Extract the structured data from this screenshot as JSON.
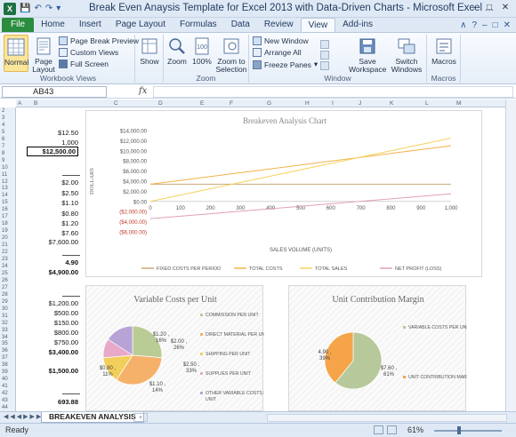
{
  "window": {
    "title": "Break Even Anaysis Template for Excel 2013 with Data-Driven Charts  -  Microsoft Excel ...",
    "file_tab": "File",
    "tabs": [
      "Home",
      "Insert",
      "Page Layout",
      "Formulas",
      "Data",
      "Review",
      "View",
      "Add-ins"
    ],
    "active_tab": "View"
  },
  "ribbon": {
    "workbook_views": {
      "label": "Workbook Views",
      "normal": "Normal",
      "page_layout": "Page Layout",
      "page_break_preview": "Page Break Preview",
      "custom_views": "Custom Views",
      "full_screen": "Full Screen"
    },
    "show": {
      "label": "Show"
    },
    "zoom": {
      "label": "Zoom",
      "zoom": "Zoom",
      "hundred": "100%",
      "zoom_to_selection": "Zoom to Selection"
    },
    "window": {
      "label": "Window",
      "new_window": "New Window",
      "arrange_all": "Arrange All",
      "freeze_panes": "Freeze Panes",
      "save_workspace": "Save Workspace",
      "switch_windows": "Switch Windows"
    },
    "macros": {
      "label": "Macros",
      "macros": "Macros"
    }
  },
  "formula_bar": {
    "name_box": "AB43",
    "fx": "fx",
    "formula": ""
  },
  "columns": [
    "A",
    "B",
    "C",
    "D",
    "E",
    "F",
    "G",
    "H",
    "I",
    "J",
    "K",
    "L",
    "M"
  ],
  "rows": [
    "2",
    "3",
    "4",
    "5",
    "6",
    "7",
    "8",
    "9",
    "10",
    "11",
    "12",
    "13",
    "14",
    "15",
    "16",
    "17",
    "18",
    "19",
    "20",
    "21",
    "22",
    "23",
    "24",
    "25",
    "26",
    "27",
    "28",
    "29",
    "30",
    "31",
    "32",
    "33",
    "34",
    "35",
    "36",
    "37",
    "38",
    "39",
    "40",
    "41",
    "42",
    "43",
    "44"
  ],
  "cells": {
    "v1": "$12.50",
    "v2": "1,000",
    "v3": "$12,500.00",
    "v4": "$2.00",
    "v5": "$2.50",
    "v6": "$1.10",
    "v7": "$0.80",
    "v8": "$1.20",
    "v9": "$7.60",
    "v10": "$7,600.00",
    "v11": "4.90",
    "v12": "$4,900.00",
    "v13": "$1,200.00",
    "v14": "$500.00",
    "v15": "$150.00",
    "v16": "$800.00",
    "v17": "$750.00",
    "v18": "$3,400.00",
    "v19": "$1,500.00",
    "v20": "693.88"
  },
  "sheet_tab": "BREAKEVEN ANALYSIS",
  "status": {
    "ready": "Ready",
    "zoom": "61%"
  },
  "colors": {
    "fixed": "#e8c99a",
    "total_costs": "#f2b24a",
    "total_sales": "#f5d35a",
    "net_profit": "#e9b3c4",
    "variable": "#8cc6ea",
    "contribution": "#f7a24d"
  },
  "chart_data": [
    {
      "type": "line",
      "title": "Breakeven  Analysis  Chart",
      "xlabel": "SALES VOLUME (UNITS)",
      "ylabel": "DOLLARS",
      "x": [
        0,
        100,
        200,
        300,
        400,
        500,
        600,
        700,
        800,
        900,
        1000
      ],
      "x_ticks": [
        "0",
        "100",
        "200",
        "300",
        "400",
        "500",
        "600",
        "700",
        "800",
        "900",
        "1,000"
      ],
      "ylim": [
        -6000,
        14000
      ],
      "y_ticks": [
        "$14,000.00",
        "$12,000.00",
        "$10,000.00",
        "$8,000.00",
        "$6,000.00",
        "$4,000.00",
        "$2,000.00",
        "$0.00",
        "($2,000.00)",
        "($4,000.00)",
        "($6,000.00)"
      ],
      "y_tick_values": [
        14000,
        12000,
        10000,
        8000,
        6000,
        4000,
        2000,
        0,
        -2000,
        -4000,
        -6000
      ],
      "series": [
        {
          "name": "FIXED COSTS PER PERIOD",
          "color": "#c9a878",
          "values": [
            3400,
            3400,
            3400,
            3400,
            3400,
            3400,
            3400,
            3400,
            3400,
            3400,
            3400
          ]
        },
        {
          "name": "TOTAL COSTS",
          "color": "#f2b24a",
          "values": [
            3400,
            4160,
            4920,
            5680,
            6440,
            7200,
            7960,
            8720,
            9480,
            10240,
            11000
          ]
        },
        {
          "name": "TOTAL SALES",
          "color": "#f5d35a",
          "values": [
            0,
            1250,
            2500,
            3750,
            5000,
            6250,
            7500,
            8750,
            10000,
            11250,
            12500
          ]
        },
        {
          "name": "NET PROFIT (LOSS)",
          "color": "#e2a0b4",
          "values": [
            -3400,
            -2910,
            -2420,
            -1930,
            -1440,
            -950,
            -460,
            30,
            520,
            1010,
            1500
          ]
        }
      ],
      "legend": "bottom"
    },
    {
      "type": "pie",
      "title": "Variable Costs per Unit",
      "slices": [
        {
          "name": "COMMISSION PER UNIT",
          "value": 2.0,
          "label": "$2.00 , 26%",
          "color": "#b9cc95"
        },
        {
          "name": "DIRECT MATERIAL PER UNIT",
          "value": 2.5,
          "label": "$2.50 , 33%",
          "color": "#f5b16a"
        },
        {
          "name": "SHIPPING PER UNIT",
          "value": 1.1,
          "label": "$1.10 , 14%",
          "color": "#f2cf5b"
        },
        {
          "name": "SUPPLIES PER UNIT",
          "value": 0.8,
          "label": "$0.80 , 11%",
          "color": "#e8a9c9"
        },
        {
          "name": "OTHER VARIABLE COSTS PER UNIT",
          "value": 1.2,
          "label": "$1.20 , 16%",
          "color": "#b8a3d6"
        }
      ],
      "legend": "right"
    },
    {
      "type": "pie",
      "title": "Unit Contribution Margin",
      "slices": [
        {
          "name": "VARIABLE COSTS PER UNIT",
          "value": 7.6,
          "label": "$7.60 , 61%",
          "color": "#b7c89a"
        },
        {
          "name": "UNIT CONTRIBUTION MARGIN",
          "value": 4.9,
          "label": "4.90 , 39%",
          "color": "#f5a44a"
        }
      ],
      "legend": "right"
    }
  ]
}
